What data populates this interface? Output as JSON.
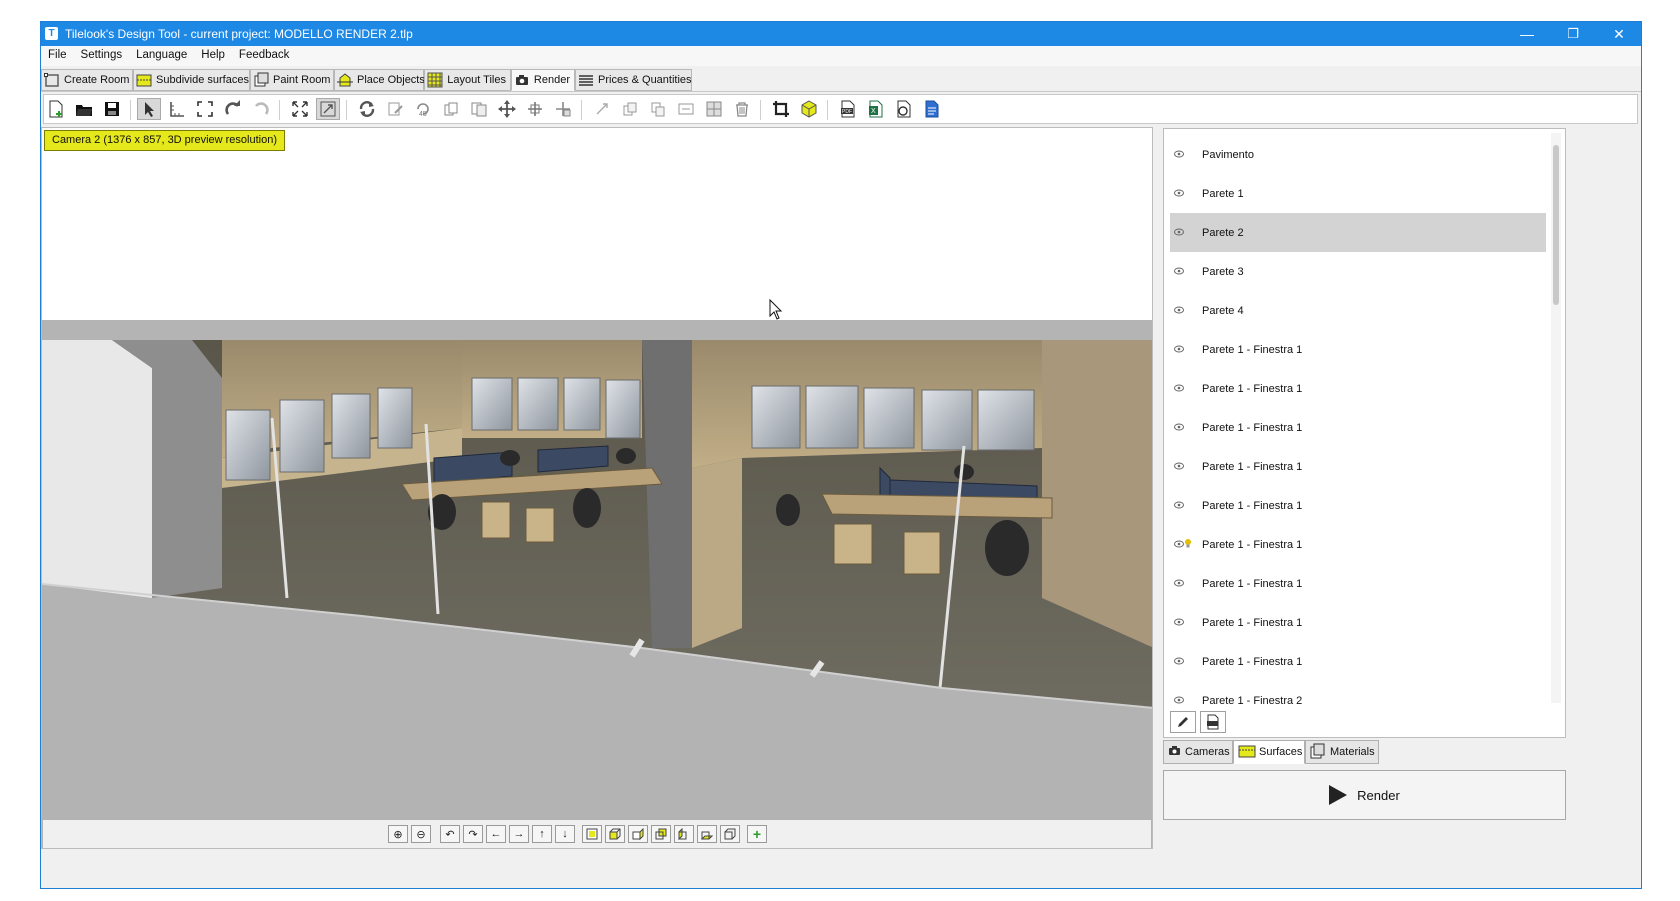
{
  "window": {
    "title": "Tilelook's Design Tool - current project: MODELLO RENDER 2.tlp",
    "app_icon_letter": "T",
    "minimize_glyph": "—",
    "restore_glyph": "❐",
    "close_glyph": "✕"
  },
  "menu": [
    "File",
    "Settings",
    "Language",
    "Help",
    "Feedback"
  ],
  "tabs": [
    {
      "label": "Create Room",
      "icon": "create-room-icon"
    },
    {
      "label": "Subdivide surfaces",
      "icon": "subdivide-icon"
    },
    {
      "label": "Paint Room",
      "icon": "paint-room-icon"
    },
    {
      "label": "Place Objects",
      "icon": "place-objects-icon"
    },
    {
      "label": "Layout Tiles",
      "icon": "layout-tiles-icon"
    },
    {
      "label": "Render",
      "icon": "camera-icon",
      "active": true
    },
    {
      "label": "Prices & Quantities",
      "icon": "list-icon"
    }
  ],
  "viewport": {
    "camera_label": "Camera 2 (1376 x 857, 3D preview resolution)"
  },
  "surfaces": [
    {
      "label": "Pavimento"
    },
    {
      "label": "Parete 1"
    },
    {
      "label": "Parete 2",
      "selected": true
    },
    {
      "label": "Parete 3"
    },
    {
      "label": "Parete 4"
    },
    {
      "label": "Parete 1 - Finestra 1"
    },
    {
      "label": "Parete 1 - Finestra 1"
    },
    {
      "label": "Parete 1 - Finestra 1"
    },
    {
      "label": "Parete 1 - Finestra 1"
    },
    {
      "label": "Parete 1 - Finestra 1"
    },
    {
      "label": "Parete 1 - Finestra 1",
      "light": true
    },
    {
      "label": "Parete 1 - Finestra 1"
    },
    {
      "label": "Parete 1 - Finestra 1"
    },
    {
      "label": "Parete 1 - Finestra 1"
    },
    {
      "label": "Parete 1 - Finestra 2"
    }
  ],
  "right_tabs": [
    {
      "label": "Cameras",
      "icon": "camera-icon"
    },
    {
      "label": "Surfaces",
      "icon": "surfaces-icon",
      "active": true
    },
    {
      "label": "Materials",
      "icon": "materials-icon"
    }
  ],
  "render_button": "Render",
  "colors": {
    "titlebar": "#1e88e5",
    "camera_label_bg": "#e5e81b",
    "selected_row": "#d3d3d3"
  }
}
